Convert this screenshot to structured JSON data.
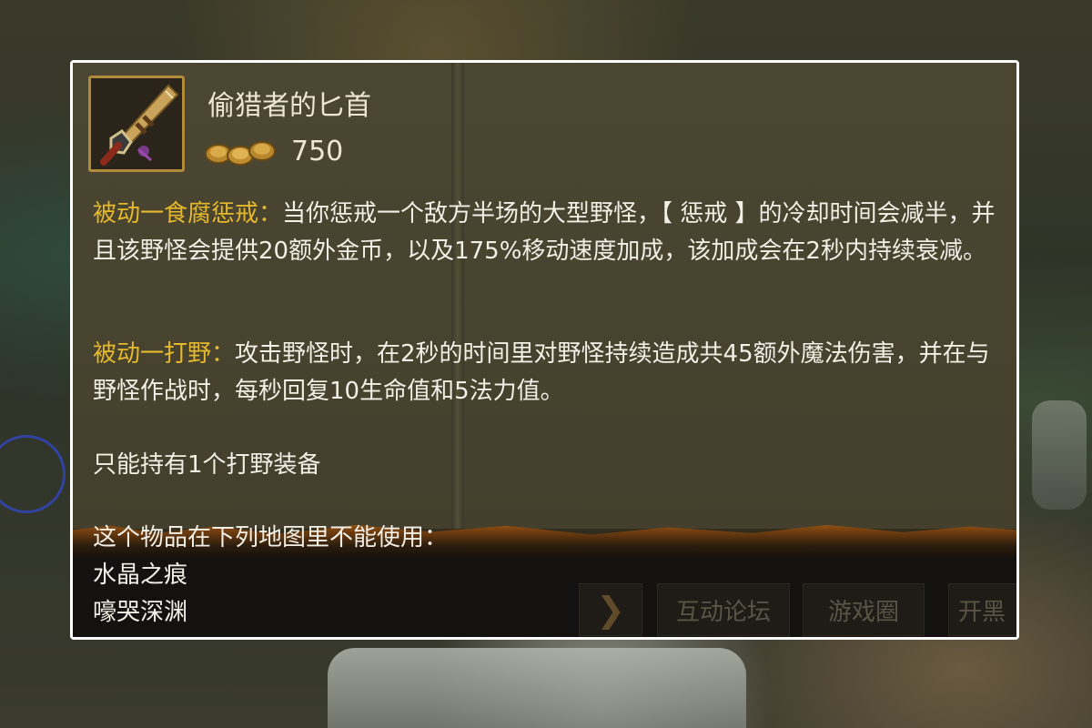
{
  "item": {
    "name": "偷猎者的匕首",
    "price": "750",
    "icon": "dagger-icon",
    "coin_icon": "gold-coins-icon"
  },
  "passives": [
    {
      "name": "被动一食腐惩戒：",
      "text": "当你惩戒一个敌方半场的大型野怪，【 惩戒 】的冷却时间会减半，并且该野怪会提供20额外金币，以及175%移动速度加成，该加成会在2秒内持续衰减。"
    },
    {
      "name": "被动一打野：",
      "text": "攻击野怪时，在2秒的时间里对野怪持续造成共45额外魔法伤害，并在与野怪作战时，每秒回复10生命值和5法力值。"
    }
  ],
  "restriction": "只能持有1个打野装备",
  "map_note": {
    "heading": "这个物品在下列地图里不能使用：",
    "maps": [
      "水晶之痕",
      "嚎哭深渊"
    ]
  },
  "nav": {
    "arrow": "❯",
    "forum": "互动论坛",
    "game_circle": "游戏圈",
    "more": "开黑"
  },
  "colors": {
    "passive_name": "#e6b92c",
    "panel_border": "#ffffff",
    "body_text": "#f2efe6"
  }
}
